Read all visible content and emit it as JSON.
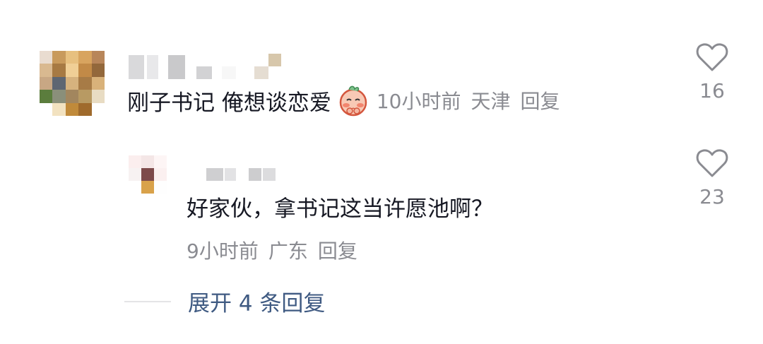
{
  "comments": [
    {
      "text": "刚子书记 俺想谈恋爱",
      "emoji": "shy-face-emoji",
      "time": "10小时前",
      "location": "天津",
      "reply_label": "回复",
      "like_count": "16"
    },
    {
      "text": "好家伙，拿书记这当许愿池啊？",
      "time": "9小时前",
      "location": "广东",
      "reply_label": "回复",
      "like_count": "23"
    }
  ],
  "expand_replies_label": "展开 4 条回复",
  "icons": {
    "like": "heart-outline-icon"
  },
  "colors": {
    "primary_text": "#161823",
    "secondary_text": "#8a8b91",
    "link": "#3f5a82"
  }
}
